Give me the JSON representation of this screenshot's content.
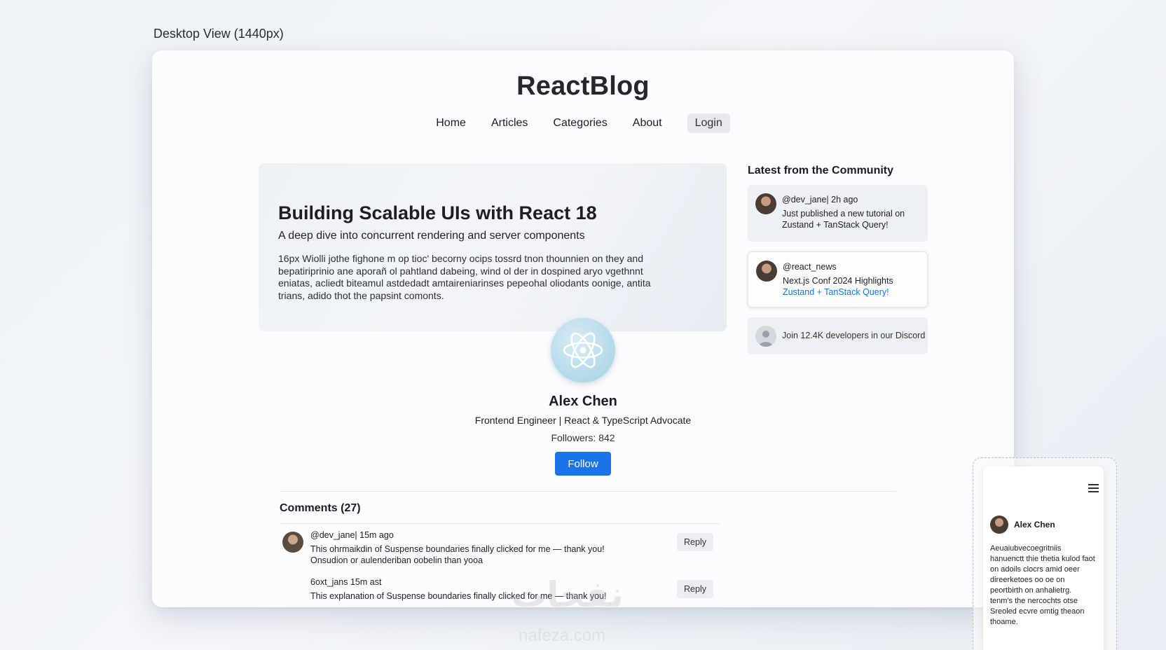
{
  "view_label": "Desktop View (1440px)",
  "header": {
    "logo": "ReactBlog",
    "nav": [
      {
        "label": "Home"
      },
      {
        "label": "Articles"
      },
      {
        "label": "Categories"
      },
      {
        "label": "About"
      },
      {
        "label": "Login"
      }
    ]
  },
  "hero": {
    "title": "Building Scalable UIs with React 18",
    "subtitle": "A deep dive into concurrent rendering and server components",
    "body": "16px Wiolli jothe fighone m op tioc' becorny ocips tossrd tnon thounnien on they and bepatiriprinio ane aporañ ol pahtland dabeing, wind ol der in dospined aryo vgethnnt eniatas, acliedt biteamul astdedadt amtaireniarinses pepeohal oliodants oonige, antita trians, adido thot the papsint comonts."
  },
  "author": {
    "name": "Alex Chen",
    "role": "Frontend Engineer | React & TypeScript Advocate",
    "followers": "Followers: 842",
    "follow_label": "Follow"
  },
  "comments": {
    "title": "Comments (27)",
    "items": [
      {
        "head": "@dev_jane| 15m ago",
        "text_1": "This ohrmaikdin of Suspense boundaries finally clicked for me — thank you!",
        "text_2": "Onsudion or aulenderiban oobelin than yooa",
        "reply": "Reply"
      },
      {
        "head": "6oxt_jans  15m ast",
        "text_1": "This explanation of Suspense boundaries finally clicked for me — thank you!",
        "reply": "Reply"
      }
    ]
  },
  "sidebar": {
    "title": "Latest from the Community",
    "cards": [
      {
        "head": "@dev_jane| 2h ago",
        "line_1": "Just published a new tutorial on",
        "line_2": "Zustand + TanStack Query!"
      },
      {
        "head": "@react_news",
        "line_1": "Next.js Conf 2024 Highlights",
        "line_2": "Zustand + TanStack Query!"
      },
      {
        "text": "Join 12.4K developers in our Discord"
      }
    ]
  },
  "mobile": {
    "name": "Alex Chen",
    "text": "Aeuaiubvecoegritniis hanuenctt thie thetia kulod faot on adoils clocrs amid oeer direerketoes oo oe on peortbirth on anhalietrg. tenm's the nercochts otse Sreoled ecvre omtig theaon thoame."
  },
  "watermark": {
    "main": "نفحات",
    "sub": "nafeza.com"
  },
  "colors": {
    "accent": "#1a73e8",
    "hero_bg": "#eef2f7"
  }
}
